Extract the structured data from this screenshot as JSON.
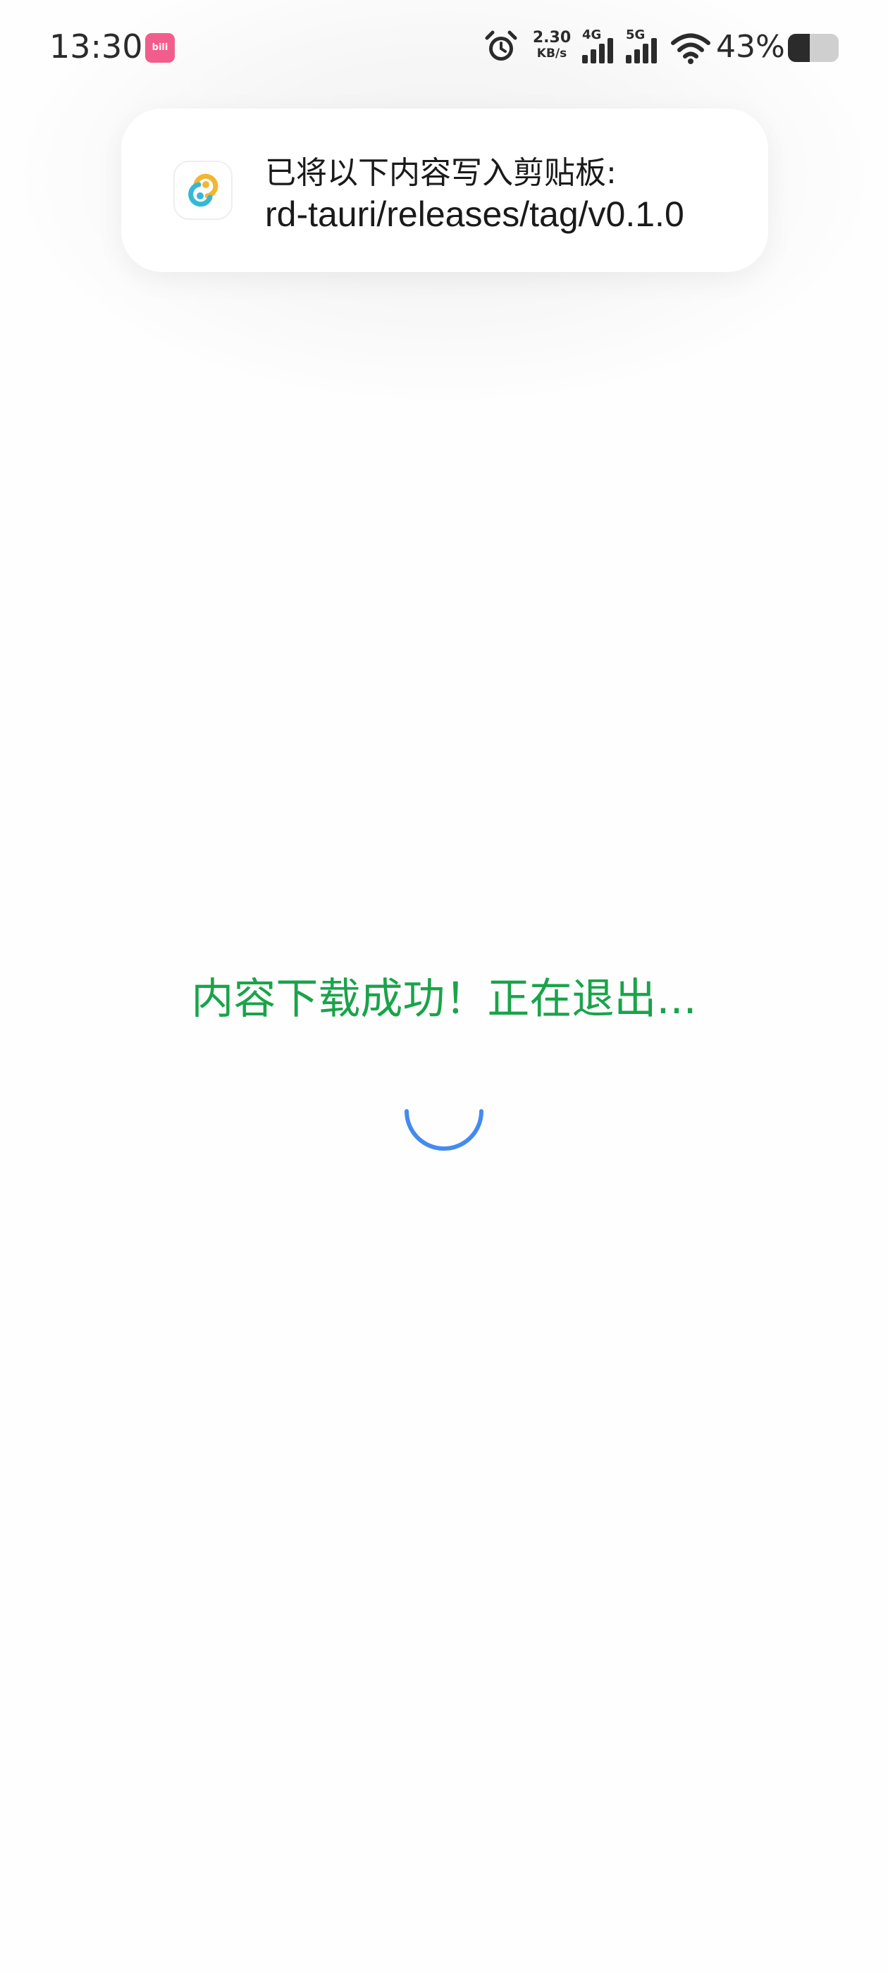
{
  "status_bar": {
    "time": "13:30",
    "notification_app_icon": "bilibili-icon",
    "notification_app_label": "bili",
    "alarm_icon": "alarm-clock-icon",
    "net_speed_value": "2.30",
    "net_speed_unit": "KB/s",
    "signal_1": {
      "label": "4G",
      "icon": "cellular-signal-icon"
    },
    "signal_2": {
      "label": "5G",
      "icon": "cellular-signal-icon"
    },
    "wifi_icon": "wifi-icon",
    "battery_percent_text": "43%",
    "battery_level": 0.43,
    "battery_icon": "battery-icon"
  },
  "clipboard_toast": {
    "app_icon": "clipboard-app-icon",
    "title": "已将以下内容写入剪贴板:",
    "content": "rd-tauri/releases/tag/v0.1.0"
  },
  "main": {
    "message": "内容下载成功！正在退出...",
    "spinner_icon": "loading-spinner-icon"
  },
  "colors": {
    "message": "#1aa34a",
    "spinner": "#3a84f0",
    "bilibili": "#f25d8e",
    "app_icon_yellow": "#f2b632",
    "app_icon_cyan": "#35b8d8"
  }
}
